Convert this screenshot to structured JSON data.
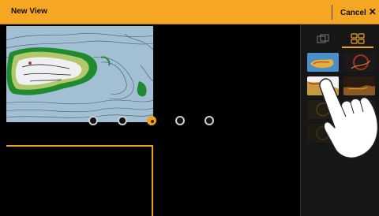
{
  "header": {
    "title": "New View",
    "cancel_label": "Cancel",
    "cancel_icon": "close-icon"
  },
  "canvas": {
    "panes": [
      {
        "name": "chart-pane",
        "content": "chart"
      },
      {
        "name": "empty-pane",
        "content": "empty"
      }
    ],
    "split_handles": {
      "count": 5,
      "selected_index": 2
    }
  },
  "sidebar": {
    "tabs": [
      {
        "name": "single-view-tab",
        "icon": "single-pane-icon"
      },
      {
        "name": "multi-view-tab",
        "icon": "grid-icon",
        "selected": true
      }
    ],
    "thumbnails": [
      {
        "name": "chart-thumbnail",
        "icon": "chart-icon"
      },
      {
        "name": "sonar-thumbnail",
        "icon": "sonar-icon"
      },
      {
        "name": "chart-thumbnail-2",
        "icon": "chart-icon"
      },
      {
        "name": "down-imaging-thumbnail",
        "icon": "sonar-icon"
      },
      {
        "name": "radar-thumbnail",
        "icon": "radar-icon"
      },
      {
        "name": "side-imaging-thumbnail",
        "icon": "sonar-icon"
      },
      {
        "name": "radar-thumbnail-2",
        "icon": "radar-icon"
      }
    ]
  },
  "colors": {
    "accent": "#f5a623",
    "handle_active": "#f0a020",
    "background": "#000000"
  }
}
